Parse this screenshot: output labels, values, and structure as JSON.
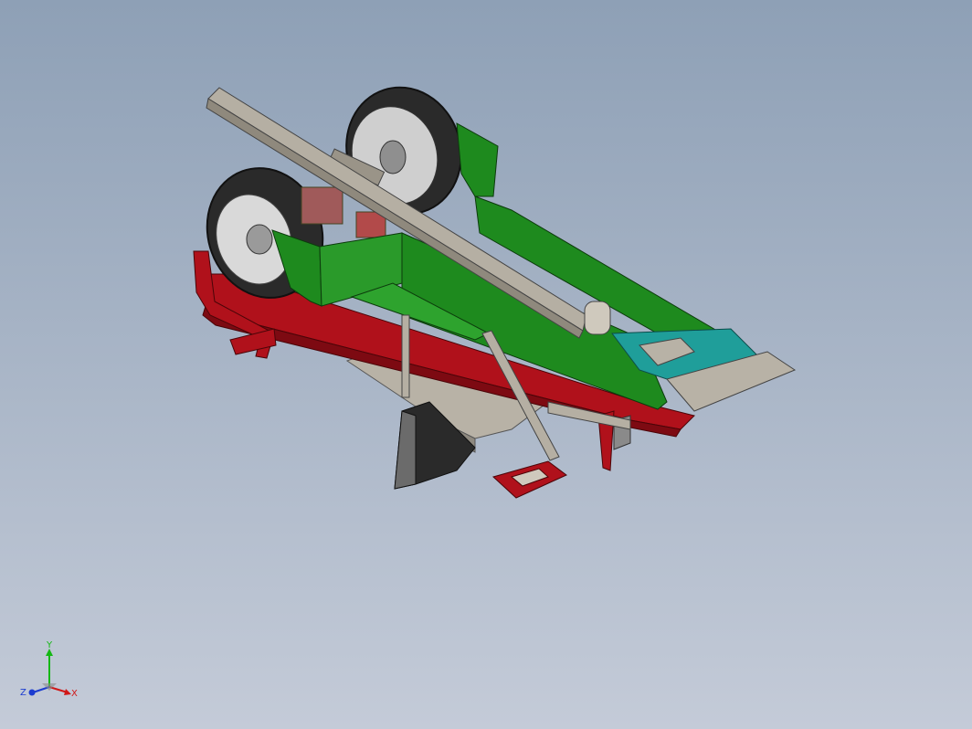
{
  "viewport": {
    "background_top": "#8ea0b6",
    "background_bottom": "#c4cbd8"
  },
  "model": {
    "colors": {
      "frame_red": "#b0111b",
      "hopper_green": "#1e8a1e",
      "tray_teal": "#1f9e9a",
      "steel_gray": "#a9a49a",
      "tire_dark": "#2a2a2a",
      "hub_light": "#d9d9d9"
    }
  },
  "triad": {
    "x_label": "X",
    "y_label": "Y",
    "z_label": "Z",
    "x_color": "#d01818",
    "y_color": "#14b814",
    "z_color": "#1c3cd0"
  }
}
